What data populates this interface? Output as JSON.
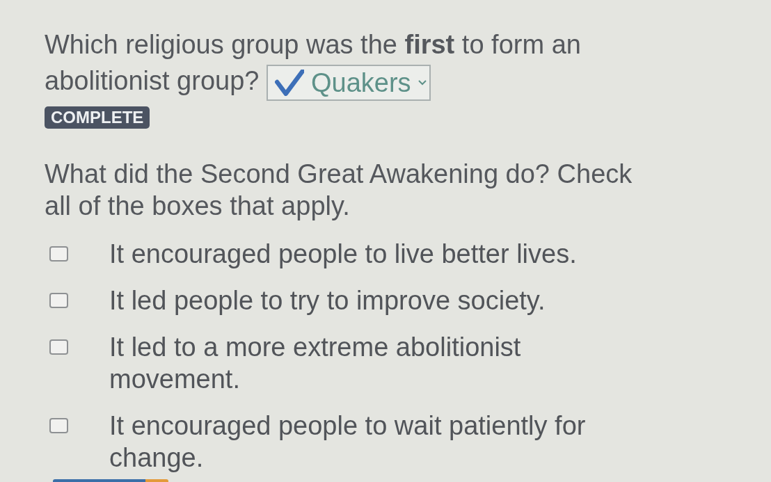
{
  "questions": [
    {
      "kind": "dropdown",
      "prompt": "Which religious group was the **first** to form an abolitionist group?",
      "answer": {
        "value": "Quakers",
        "correct": true
      },
      "status": "COMPLETE"
    },
    {
      "kind": "checkbox",
      "prompt": "What did the Second Great Awakening do? Check all of the boxes that apply.",
      "options": [
        {
          "label": "It encouraged people to live better lives.",
          "checked": false
        },
        {
          "label": "It led people to try to improve society.",
          "checked": false
        },
        {
          "label": "It led to a more extreme abolitionist movement.",
          "checked": false
        },
        {
          "label": "It encouraged people to wait patiently for change.",
          "checked": false
        }
      ]
    }
  ]
}
